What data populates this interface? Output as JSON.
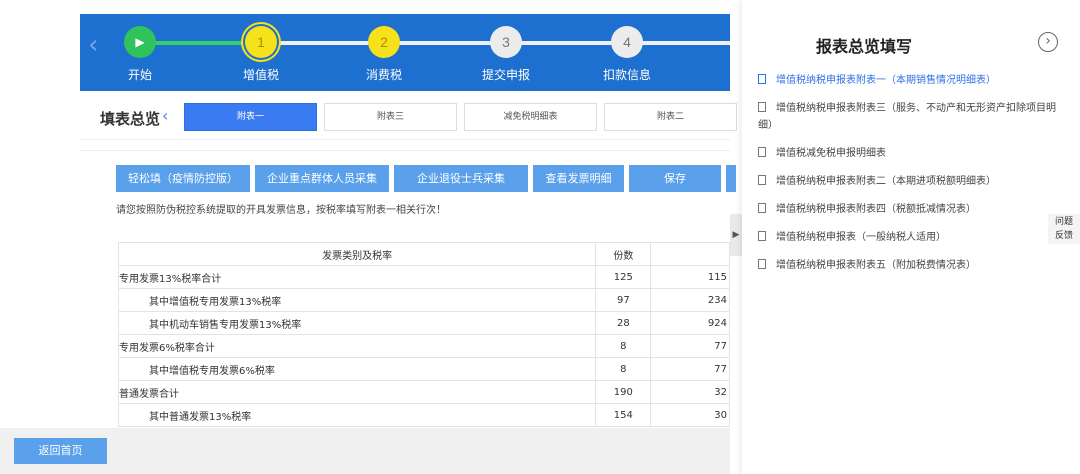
{
  "steps": [
    {
      "label": "开始",
      "marker": "▶"
    },
    {
      "label": "增值税",
      "marker": "1"
    },
    {
      "label": "消费税",
      "marker": "2"
    },
    {
      "label": "提交申报",
      "marker": "3"
    },
    {
      "label": "扣款信息",
      "marker": "4"
    }
  ],
  "tabs": {
    "title": "填表总览",
    "items": [
      "附表一",
      "附表三",
      "减免税明细表",
      "附表二"
    ]
  },
  "buttons": [
    "轻松填（疫情防控版）",
    "企业重点群体人员采集",
    "企业退役士兵采集",
    "查看发票明细",
    "保存"
  ],
  "notice": "请您按照防伪税控系统提取的开具发票信息，按税率填写附表一相关行次！",
  "table": {
    "headers": [
      "发票类别及税率",
      "份数",
      ""
    ],
    "rows": [
      {
        "name": "专用发票13%税率合计",
        "count": "125",
        "amount": "115"
      },
      {
        "name": "其中增值税专用发票13%税率",
        "count": "97",
        "amount": "234"
      },
      {
        "name": "其中机动车销售专用发票13%税率",
        "count": "28",
        "amount": "924"
      },
      {
        "name": "专用发票6%税率合计",
        "count": "8",
        "amount": "77"
      },
      {
        "name": "其中增值税专用发票6%税率",
        "count": "8",
        "amount": "77"
      },
      {
        "name": "普通发票合计",
        "count": "190",
        "amount": "32"
      },
      {
        "name": "其中普通发票13%税率",
        "count": "154",
        "amount": "30"
      }
    ]
  },
  "bottom": {
    "home": "返回首页"
  },
  "drawer": {
    "handle": "▶",
    "title": "报表总览填写",
    "close": "›",
    "items": [
      "增值税纳税申报表附表一（本期销售情况明细表）",
      "增值税纳税申报表附表三（服务、不动产和无形资产扣除项目明细）",
      "增值税减免税申报明细表",
      "增值税纳税申报表附表二（本期进项税额明细表）",
      "增值税纳税申报表附表四（税额抵减情况表）",
      "增值税纳税申报表（一般纳税人适用）",
      "增值税纳税申报表附表五（附加税费情况表）"
    ]
  },
  "feedback": {
    "line1": "问题",
    "line2": "反馈"
  },
  "colors": {
    "stepbar": "#1d6fd0",
    "accent": "#3a7bf2",
    "button": "#5aa0ea",
    "active_link": "#2f6fe6"
  }
}
